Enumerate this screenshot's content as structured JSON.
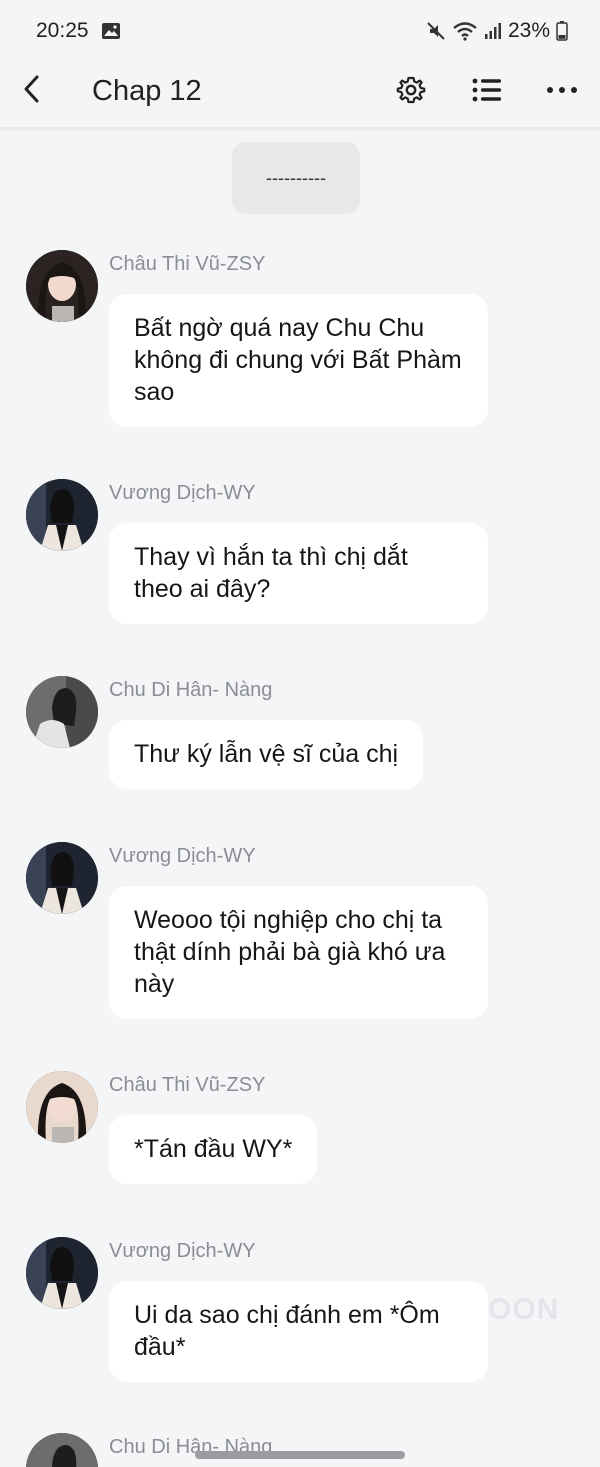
{
  "status_bar": {
    "time": "20:25",
    "battery": "23%"
  },
  "app_bar": {
    "title": "Chap 12"
  },
  "divider": "----------",
  "messages": [
    {
      "sender": "Châu Thi Vũ-ZSY",
      "text": "Bất ngờ quá nay Chu Chu không đi chung với Bất Phàm sao",
      "avatar_style": "light-hair"
    },
    {
      "sender": "Vương Dịch-WY",
      "text": "Thay vì hắn ta thì chị dắt theo ai đây?",
      "avatar_style": "dark-jacket"
    },
    {
      "sender": "Chu Di Hân- Nàng",
      "text": "Thư ký lẫn vệ sĩ của chị",
      "avatar_style": "grey-photo"
    },
    {
      "sender": "Vương Dịch-WY",
      "text": "Weooo tội nghiệp cho chị ta thật dính phải bà già khó ưa này",
      "avatar_style": "dark-jacket"
    },
    {
      "sender": "Châu Thi Vũ-ZSY",
      "text": "*Tán đầu WY*",
      "avatar_style": "light-hair"
    },
    {
      "sender": "Vương Dịch-WY",
      "text": "Ui da sao chị đánh em *Ôm đầu*",
      "avatar_style": "dark-jacket"
    },
    {
      "sender": "Chu Di Hân- Nàng",
      "text": "",
      "avatar_style": "grey-photo"
    }
  ],
  "watermark": "OON",
  "colors": {
    "background": "#f4f5f7",
    "bubble": "#ffffff",
    "sender_name": "#8a8d93",
    "divider_chip": "#e7e8ea"
  }
}
